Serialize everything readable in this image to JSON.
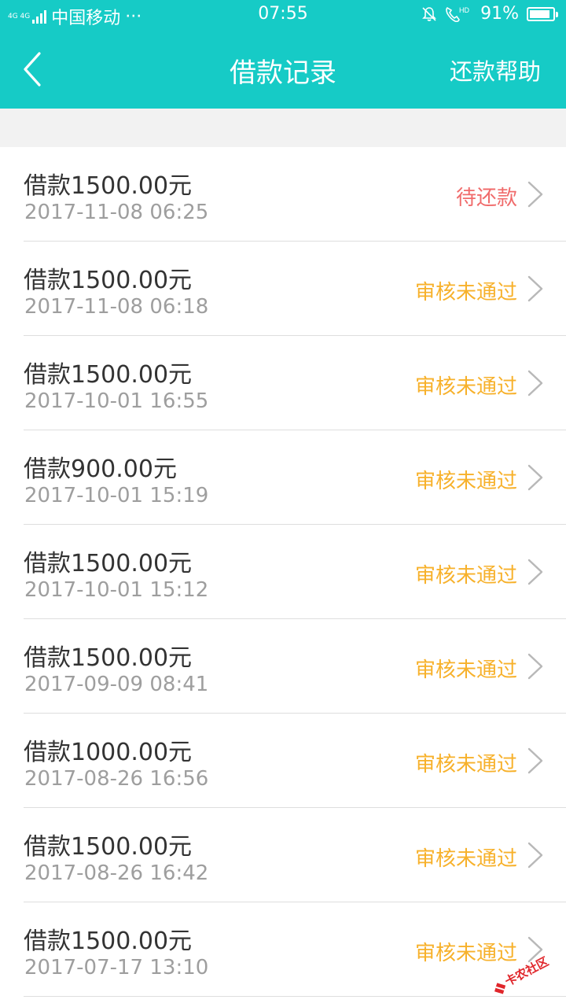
{
  "status_bar": {
    "network": "4G 4G",
    "carrier": "中国移动",
    "more": "···",
    "time": "07:55",
    "battery": "91%",
    "battery_level": 0.91
  },
  "header": {
    "title": "借款记录",
    "help": "还款帮助",
    "back_icon": "chevron-left-icon"
  },
  "colors": {
    "teal": "#16cbc6",
    "pending": "#f06b6b",
    "rejected": "#f7b12b"
  },
  "records": [
    {
      "amount": "借款1500.00元",
      "time": "2017-11-08 06:25",
      "status": "待还款",
      "type": "pending"
    },
    {
      "amount": "借款1500.00元",
      "time": "2017-11-08 06:18",
      "status": "审核未通过",
      "type": "rejected"
    },
    {
      "amount": "借款1500.00元",
      "time": "2017-10-01 16:55",
      "status": "审核未通过",
      "type": "rejected"
    },
    {
      "amount": "借款900.00元",
      "time": "2017-10-01 15:19",
      "status": "审核未通过",
      "type": "rejected"
    },
    {
      "amount": "借款1500.00元",
      "time": "2017-10-01 15:12",
      "status": "审核未通过",
      "type": "rejected"
    },
    {
      "amount": "借款1500.00元",
      "time": "2017-09-09 08:41",
      "status": "审核未通过",
      "type": "rejected"
    },
    {
      "amount": "借款1000.00元",
      "time": "2017-08-26 16:56",
      "status": "审核未通过",
      "type": "rejected"
    },
    {
      "amount": "借款1500.00元",
      "time": "2017-08-26 16:42",
      "status": "审核未通过",
      "type": "rejected"
    },
    {
      "amount": "借款1500.00元",
      "time": "2017-07-17 13:10",
      "status": "审核未通过",
      "type": "rejected"
    }
  ],
  "watermark": "卡农社区"
}
